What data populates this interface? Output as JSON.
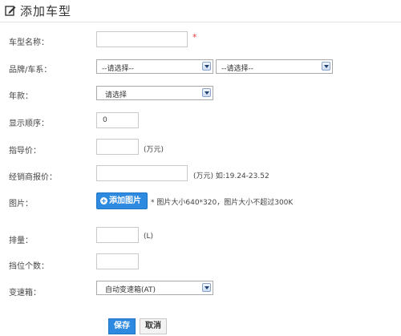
{
  "header": {
    "title": "添加车型",
    "icon": "edit-icon"
  },
  "form": {
    "model_name": {
      "label": "车型名称：",
      "value": "",
      "required_mark": "*"
    },
    "brand_series": {
      "label": "品牌/车系：",
      "brand_selected": "--请选择--",
      "series_selected": "--请选择--"
    },
    "year": {
      "label": "年款：",
      "selected": "请选择"
    },
    "display_order": {
      "label": "显示顺序：",
      "value": "0"
    },
    "guide_price": {
      "label": "指导价：",
      "value": "",
      "unit": "(万元)"
    },
    "dealer_price": {
      "label": "经销商报价：",
      "value": "",
      "hint": "(万元) 如:19.24-23.52"
    },
    "image": {
      "label": "图片：",
      "button": "添加图片",
      "hint": "* 图片大小640*320，图片大小不超过300K"
    },
    "displacement": {
      "label": "排量：",
      "value": "",
      "unit": "(L)"
    },
    "gear_count": {
      "label": "挡位个数：",
      "value": ""
    },
    "transmission": {
      "label": "变速箱：",
      "selected": "自动变速箱(AT)"
    }
  },
  "actions": {
    "save": "保存",
    "cancel": "取消"
  },
  "colors": {
    "accent": "#2d8ae0",
    "required": "#e4393c"
  }
}
